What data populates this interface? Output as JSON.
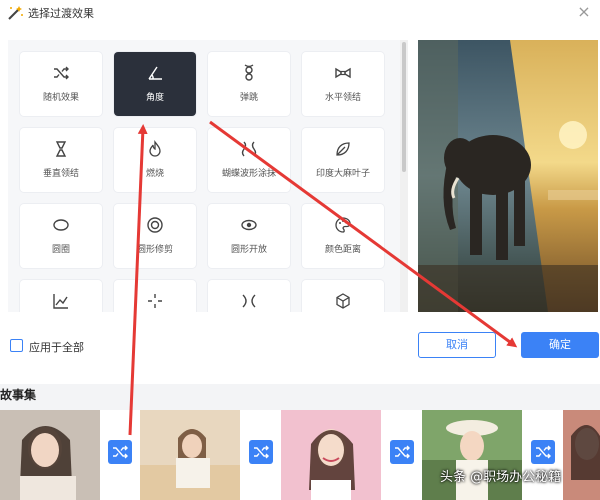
{
  "dialog": {
    "title": "选择过渡效果",
    "close_label": "×"
  },
  "transitions": [
    {
      "label": "随机效果",
      "icon": "shuffle-icon",
      "active": false
    },
    {
      "label": "角度",
      "icon": "angle-icon",
      "active": true
    },
    {
      "label": "弹跳",
      "icon": "bounce-icon",
      "active": false
    },
    {
      "label": "水平领结",
      "icon": "bowtie-horizontal-icon",
      "active": false
    },
    {
      "label": "垂直领结",
      "icon": "bowtie-vertical-icon",
      "active": false
    },
    {
      "label": "燃烧",
      "icon": "flame-icon",
      "active": false
    },
    {
      "label": "蝴蝶波形涂抹",
      "icon": "butterfly-wave-icon",
      "active": false
    },
    {
      "label": "印度大麻叶子",
      "icon": "leaf-icon",
      "active": false
    },
    {
      "label": "圆圈",
      "icon": "ellipse-icon",
      "active": false
    },
    {
      "label": "圆形修剪",
      "icon": "circle-crop-icon",
      "active": false
    },
    {
      "label": "圆形开放",
      "icon": "circle-open-icon",
      "active": false
    },
    {
      "label": "颜色距离",
      "icon": "palette-icon",
      "active": false
    },
    {
      "label": "",
      "icon": "line-chart-icon",
      "active": false
    },
    {
      "label": "",
      "icon": "crosshair-icon",
      "active": false
    },
    {
      "label": "",
      "icon": "cross-warp-icon",
      "active": false
    },
    {
      "label": "",
      "icon": "cube-icon",
      "active": false
    }
  ],
  "apply_all": {
    "label": "应用于全部",
    "checked": false
  },
  "buttons": {
    "cancel": "取消",
    "ok": "确定"
  },
  "story": {
    "title": "故事集"
  },
  "watermark": "头条 @职场办公秘籍",
  "colors": {
    "accent": "#3b82f6",
    "active_tile": "#2b303b",
    "annotation_arrow": "#e53935"
  }
}
